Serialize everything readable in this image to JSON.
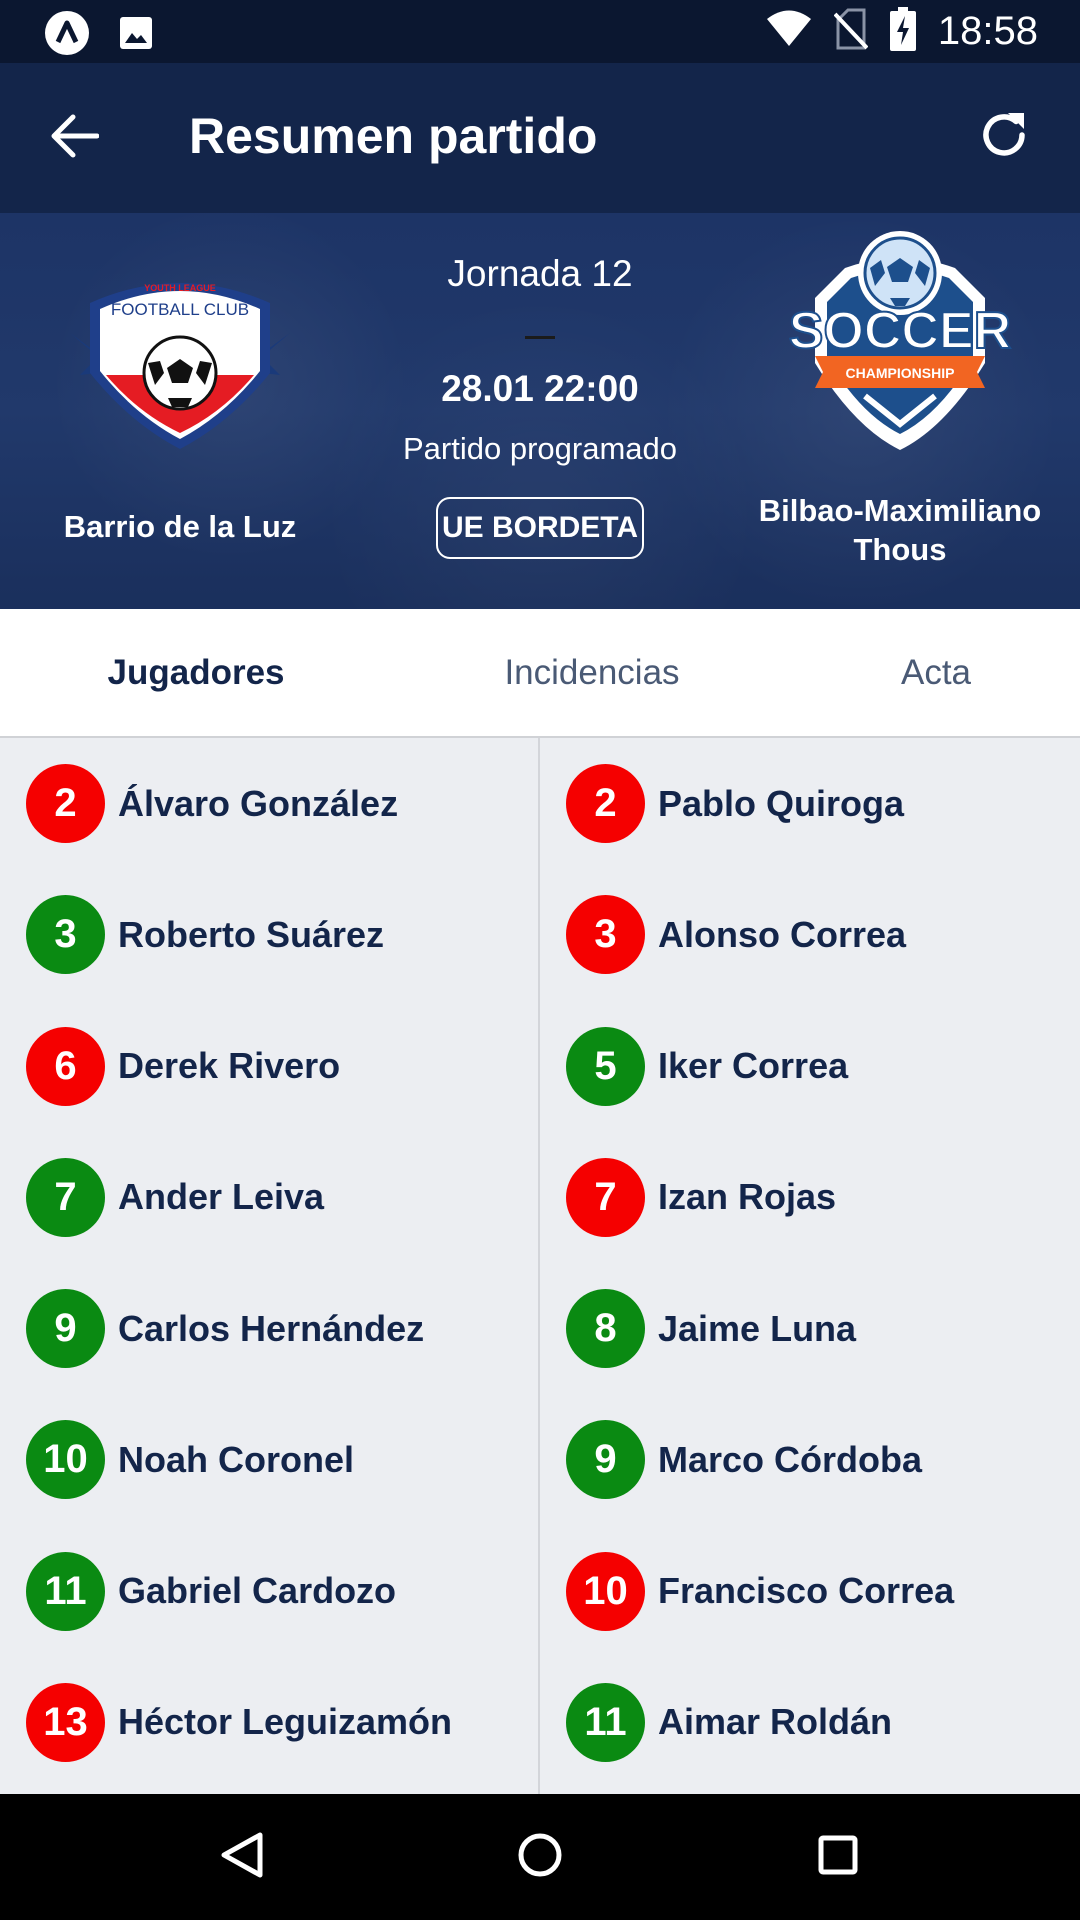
{
  "status_bar": {
    "time": "18:58",
    "icons": [
      "app-launcher-icon",
      "image-icon",
      "wifi-icon",
      "no-sim-icon",
      "battery-charging-icon"
    ]
  },
  "app_bar": {
    "title": "Resumen partido",
    "back_icon": "arrow-left-icon",
    "refresh_icon": "refresh-icon"
  },
  "match": {
    "round": "Jornada 12",
    "datetime": "28.01 22:00",
    "status": "Partido programado",
    "venue": "UE BORDETA",
    "home": {
      "name": "Barrio de la Luz",
      "logo_lines": [
        "YOUTH LEAGUE",
        "FOOTBALL CLUB"
      ]
    },
    "away": {
      "name": "Bilbao-Maximiliano Thous",
      "logo_lines": [
        "SOCCER",
        "CHAMPIONSHIP"
      ]
    }
  },
  "tabs": [
    {
      "label": "Jugadores",
      "active": true
    },
    {
      "label": "Incidencias",
      "active": false
    },
    {
      "label": "Acta",
      "active": false
    }
  ],
  "colors": {
    "red": "#f50000",
    "green": "#0a8a12",
    "navy": "#13254a"
  },
  "home_players": [
    {
      "number": "2",
      "name": "Álvaro González",
      "color": "red"
    },
    {
      "number": "3",
      "name": "Roberto Suárez",
      "color": "green"
    },
    {
      "number": "6",
      "name": "Derek Rivero",
      "color": "red"
    },
    {
      "number": "7",
      "name": "Ander Leiva",
      "color": "green"
    },
    {
      "number": "9",
      "name": "Carlos Hernández",
      "color": "green"
    },
    {
      "number": "10",
      "name": "Noah Coronel",
      "color": "green"
    },
    {
      "number": "11",
      "name": "Gabriel Cardozo",
      "color": "green"
    },
    {
      "number": "13",
      "name": "Héctor Leguizamón",
      "color": "red"
    }
  ],
  "away_players": [
    {
      "number": "2",
      "name": "Pablo Quiroga",
      "color": "red"
    },
    {
      "number": "3",
      "name": "Alonso Correa",
      "color": "red"
    },
    {
      "number": "5",
      "name": "Iker Correa",
      "color": "green"
    },
    {
      "number": "7",
      "name": "Izan Rojas",
      "color": "red"
    },
    {
      "number": "8",
      "name": "Jaime Luna",
      "color": "green"
    },
    {
      "number": "9",
      "name": "Marco Córdoba",
      "color": "green"
    },
    {
      "number": "10",
      "name": "Francisco Correa",
      "color": "red"
    },
    {
      "number": "11",
      "name": "Aimar Roldán",
      "color": "green"
    }
  ]
}
